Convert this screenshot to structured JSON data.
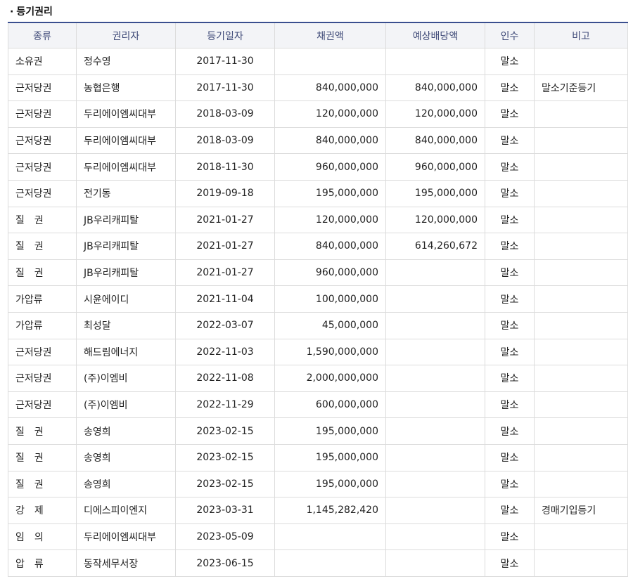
{
  "section": {
    "bullet": "·",
    "title": "등기권리"
  },
  "columns": [
    "종류",
    "권리자",
    "등기일자",
    "채권액",
    "예상배당액",
    "인수",
    "비고"
  ],
  "rows": [
    {
      "type": "소유권",
      "holder": "정수영",
      "date": "2017-11-30",
      "amount": "",
      "dividend": "",
      "takeover": "말소",
      "note": ""
    },
    {
      "type": "근저당권",
      "holder": "농협은행",
      "date": "2017-11-30",
      "amount": "840,000,000",
      "dividend": "840,000,000",
      "takeover": "말소",
      "note": "말소기준등기"
    },
    {
      "type": "근저당권",
      "holder": "두리에이엠씨대부",
      "date": "2018-03-09",
      "amount": "120,000,000",
      "dividend": "120,000,000",
      "takeover": "말소",
      "note": ""
    },
    {
      "type": "근저당권",
      "holder": "두리에이엠씨대부",
      "date": "2018-03-09",
      "amount": "840,000,000",
      "dividend": "840,000,000",
      "takeover": "말소",
      "note": ""
    },
    {
      "type": "근저당권",
      "holder": "두리에이엠씨대부",
      "date": "2018-11-30",
      "amount": "960,000,000",
      "dividend": "960,000,000",
      "takeover": "말소",
      "note": ""
    },
    {
      "type": "근저당권",
      "holder": "전기동",
      "date": "2019-09-18",
      "amount": "195,000,000",
      "dividend": "195,000,000",
      "takeover": "말소",
      "note": ""
    },
    {
      "type": "질　권",
      "holder": "JB우리캐피탈",
      "date": "2021-01-27",
      "amount": "120,000,000",
      "dividend": "120,000,000",
      "takeover": "말소",
      "note": ""
    },
    {
      "type": "질　권",
      "holder": "JB우리캐피탈",
      "date": "2021-01-27",
      "amount": "840,000,000",
      "dividend": "614,260,672",
      "takeover": "말소",
      "note": ""
    },
    {
      "type": "질　권",
      "holder": "JB우리캐피탈",
      "date": "2021-01-27",
      "amount": "960,000,000",
      "dividend": "",
      "takeover": "말소",
      "note": ""
    },
    {
      "type": "가압류",
      "holder": "시윤에이디",
      "date": "2021-11-04",
      "amount": "100,000,000",
      "dividend": "",
      "takeover": "말소",
      "note": ""
    },
    {
      "type": "가압류",
      "holder": "최성달",
      "date": "2022-03-07",
      "amount": "45,000,000",
      "dividend": "",
      "takeover": "말소",
      "note": ""
    },
    {
      "type": "근저당권",
      "holder": "해드림에너지",
      "date": "2022-11-03",
      "amount": "1,590,000,000",
      "dividend": "",
      "takeover": "말소",
      "note": ""
    },
    {
      "type": "근저당권",
      "holder": "(주)이엠비",
      "date": "2022-11-08",
      "amount": "2,000,000,000",
      "dividend": "",
      "takeover": "말소",
      "note": ""
    },
    {
      "type": "근저당권",
      "holder": "(주)이엠비",
      "date": "2022-11-29",
      "amount": "600,000,000",
      "dividend": "",
      "takeover": "말소",
      "note": ""
    },
    {
      "type": "질　권",
      "holder": "송영희",
      "date": "2023-02-15",
      "amount": "195,000,000",
      "dividend": "",
      "takeover": "말소",
      "note": ""
    },
    {
      "type": "질　권",
      "holder": "송영희",
      "date": "2023-02-15",
      "amount": "195,000,000",
      "dividend": "",
      "takeover": "말소",
      "note": ""
    },
    {
      "type": "질　권",
      "holder": "송영희",
      "date": "2023-02-15",
      "amount": "195,000,000",
      "dividend": "",
      "takeover": "말소",
      "note": ""
    },
    {
      "type": "강　제",
      "holder": "디에스피이엔지",
      "date": "2023-03-31",
      "amount": "1,145,282,420",
      "dividend": "",
      "takeover": "말소",
      "note": "경매기입등기"
    },
    {
      "type": "임　의",
      "holder": "두리에이엠씨대부",
      "date": "2023-05-09",
      "amount": "",
      "dividend": "",
      "takeover": "말소",
      "note": ""
    },
    {
      "type": "압　류",
      "holder": "동작세무서장",
      "date": "2023-06-15",
      "amount": "",
      "dividend": "",
      "takeover": "말소",
      "note": ""
    }
  ],
  "colors": {
    "header_border": "#3a4f8f",
    "header_bg": "#f3f4f7",
    "header_text": "#3f4a78",
    "grid": "#dcdcdc"
  }
}
